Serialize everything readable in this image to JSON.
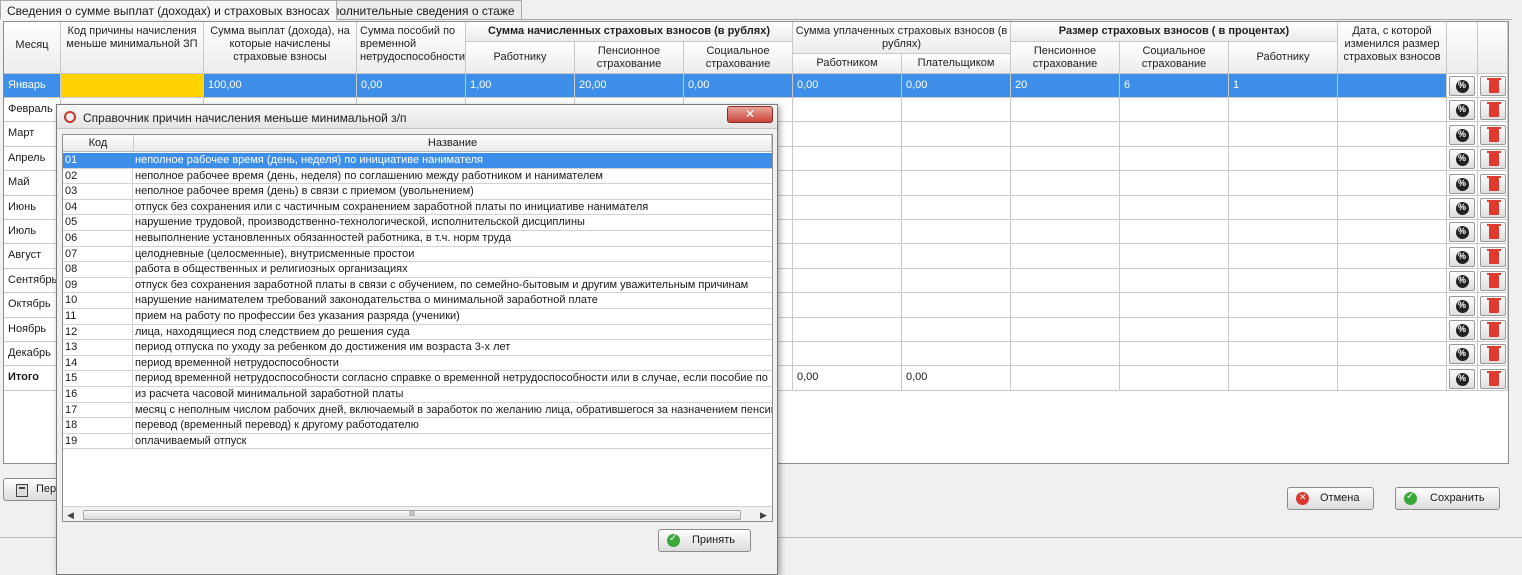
{
  "tabs": [
    {
      "label": "Сведения о сумме выплат (доходах) и страховых взносах"
    },
    {
      "label": "Дополнительные сведения о стаже"
    }
  ],
  "grid": {
    "headers": {
      "month": "Месяц",
      "reason_code": "Код причины начисления меньше минимальной ЗП",
      "payments_sum": "Сумма выплат (дохода), на которые начислены страховые взносы",
      "benefits_sum": "Сумма пособий по временной нетрудоспособности",
      "accrued_group": "Сумма начисленных страховых взносов (в рублях)",
      "accrued_employee": "Работнику",
      "accrued_pension": "Пенсионное страхование",
      "accrued_social": "Социальное страхование",
      "paid_group": "Сумма уплаченных страховых взносов (в рублях)",
      "paid_employee": "Работником",
      "paid_payer": "Плательщиком",
      "rate_group": "Размер страховых взносов ( в процентах)",
      "rate_pension": "Пенсионное страхование",
      "rate_social": "Социальное страхование",
      "rate_employee": "Работнику",
      "change_date": "Дата, с которой изменился размер страховых взносов"
    },
    "first_row": {
      "month": "Январь",
      "payments_sum": "100,00",
      "benefits_sum": "0,00",
      "accrued_employee": "1,00",
      "accrued_pension": "20,00",
      "accrued_social": "0,00",
      "paid_employee": "0,00",
      "paid_payer": "0,00",
      "rate_pension": "20",
      "rate_social": "6",
      "rate_employee": "1"
    },
    "months": [
      "Февраль",
      "Март",
      "Апрель",
      "Май",
      "Июнь",
      "Июль",
      "Август",
      "Сентябрь",
      "Октябрь",
      "Ноябрь",
      "Декабрь"
    ],
    "total": {
      "label": "Итого",
      "paid_employee": "0,00",
      "paid_payer": "0,00"
    }
  },
  "buttons": {
    "calc_label": "Пер",
    "cancel_label": "Отмена",
    "save_label": "Сохранить"
  },
  "dialog": {
    "title": "Справочник причин начисления меньше минимальной з/п",
    "close_label": "✕",
    "col_code": "Код",
    "col_name": "Название",
    "accept_label": "Принять",
    "scroll_grip": "III",
    "rows": [
      {
        "code": "01",
        "name": "неполное рабочее время (день, неделя) по инициативе нанимателя"
      },
      {
        "code": "02",
        "name": "неполное рабочее время (день, неделя) по соглашению между работником и нанимателем"
      },
      {
        "code": "03",
        "name": "неполное рабочее время (день) в связи с приемом (увольнением)"
      },
      {
        "code": "04",
        "name": "отпуск без сохранения или с частичным сохранением заработной платы по инициативе нанимателя"
      },
      {
        "code": "05",
        "name": "нарушение трудовой, производственно-технологической, исполнительской дисциплины"
      },
      {
        "code": "06",
        "name": "невыполнение установленных обязанностей работника, в т.ч. норм труда"
      },
      {
        "code": "07",
        "name": "целодневные (целосменные), внутрисменные простои"
      },
      {
        "code": "08",
        "name": "работа в общественных и религиозных организациях"
      },
      {
        "code": "09",
        "name": "отпуск без сохранения заработной платы в связи с обучением, по семейно-бытовым и другим уважительным причинам"
      },
      {
        "code": "10",
        "name": "нарушение нанимателем требований законодательства о минимальной заработной плате"
      },
      {
        "code": "11",
        "name": "прием на работу по профессии без указания разряда (ученики)"
      },
      {
        "code": "12",
        "name": "лица, находящиеся под следствием до решения суда"
      },
      {
        "code": "13",
        "name": "период отпуска по уходу за ребенком до достижения им возраста 3-х лет"
      },
      {
        "code": "14",
        "name": "период временной нетрудоспособности"
      },
      {
        "code": "15",
        "name": "период временной нетрудоспособности согласно справке о временной нетрудоспособности или в случае, если пособие по ..."
      },
      {
        "code": "16",
        "name": "из расчета часовой минимальной заработной платы"
      },
      {
        "code": "17",
        "name": "месяц с неполным числом рабочих дней, включаемый в заработок по желанию лица, обратившегося за назначением пенсии"
      },
      {
        "code": "18",
        "name": "перевод (временный перевод) к другому работодателю"
      },
      {
        "code": "19",
        "name": "оплачиваемый отпуск"
      }
    ]
  },
  "colors": {
    "selection": "#3d8ee8",
    "highlight": "#ffd200"
  }
}
